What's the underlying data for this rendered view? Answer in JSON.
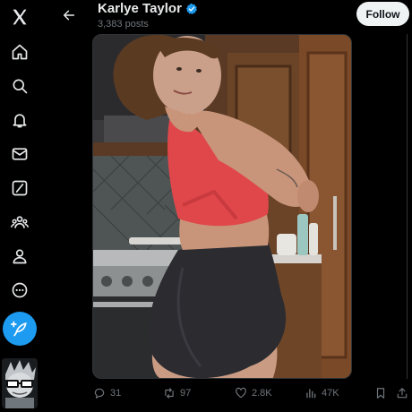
{
  "nav": {
    "items": [
      {
        "name": "x-logo-icon"
      },
      {
        "name": "home-icon"
      },
      {
        "name": "search-icon"
      },
      {
        "name": "notifications-bell-icon"
      },
      {
        "name": "messages-envelope-icon"
      },
      {
        "name": "grok-slash-icon"
      },
      {
        "name": "communities-icon"
      },
      {
        "name": "profile-icon"
      },
      {
        "name": "more-circle-icon"
      }
    ],
    "compose_icon": "feather-plus-icon",
    "accent_color": "#1d9bf0"
  },
  "header": {
    "profile_name": "Karlye Taylor",
    "post_count": "3,383 posts",
    "follow_label": "Follow"
  },
  "post": {
    "replies": "31",
    "reposts": "97",
    "likes": "2.8K",
    "views": "47K"
  }
}
